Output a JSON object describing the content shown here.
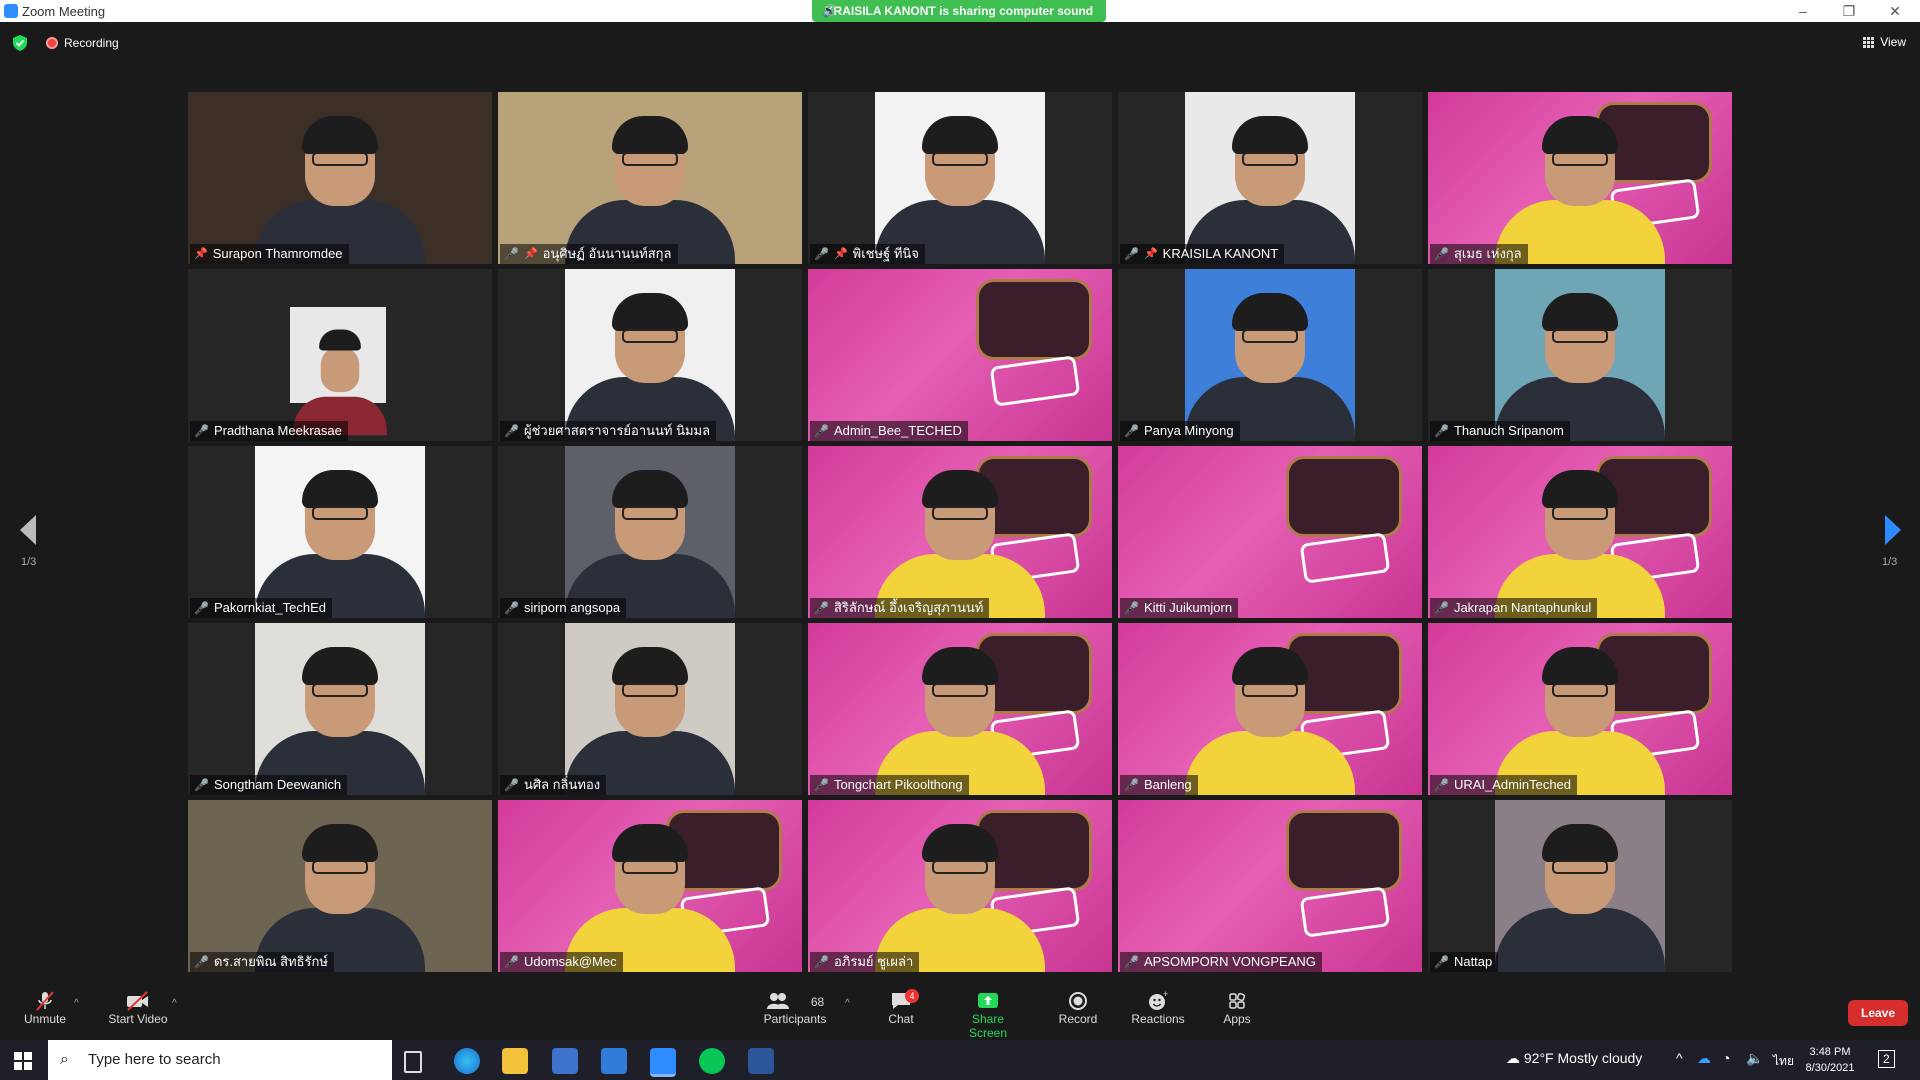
{
  "window": {
    "title": "Zoom Meeting",
    "minimize": "–",
    "maximize": "❐",
    "close": "✕"
  },
  "share_banner": "KRAISILA KANONT is sharing computer sound",
  "recording": {
    "label": "Recording"
  },
  "view": {
    "label": "View"
  },
  "pager": {
    "left": "1/3",
    "right": "1/3"
  },
  "participants": [
    {
      "name": "Surapon Thamromdee",
      "pinned": true,
      "muted": false,
      "bg": "#3b2f27",
      "type": "person"
    },
    {
      "name": "อนุศิษฏ์ อันนานนท์สกุล",
      "pinned": true,
      "muted": true,
      "bg": "#b8a27a",
      "type": "person"
    },
    {
      "name": "พิเชษฐ์ ทีนิจ",
      "pinned": true,
      "muted": true,
      "bg": "#f2f2f2",
      "type": "photo"
    },
    {
      "name": "KRAISILA KANONT",
      "pinned": true,
      "muted": true,
      "bg": "#e9e9e9",
      "type": "photo"
    },
    {
      "name": "สุเมธ เห่งกุล",
      "pinned": false,
      "muted": true,
      "bg": "pink",
      "type": "person"
    },
    {
      "name": "Pradthana Meekrasae",
      "pinned": false,
      "muted": true,
      "bg": "#e8e8e8",
      "type": "small-photo"
    },
    {
      "name": "ผู้ช่วยศาสตราจารย์อานนท์ นิมมล",
      "pinned": false,
      "muted": true,
      "bg": "#f0f0f0",
      "type": "photo"
    },
    {
      "name": "Admin_Bee_TECHED",
      "pinned": false,
      "muted": true,
      "bg": "pink",
      "type": "banner"
    },
    {
      "name": "Panya Minyong",
      "pinned": false,
      "muted": true,
      "bg": "#3d7fd9",
      "type": "photo"
    },
    {
      "name": "Thanuch Sripanom",
      "pinned": false,
      "muted": true,
      "bg": "#6fa6b5",
      "type": "photo"
    },
    {
      "name": "Pakornkiat_TechEd",
      "pinned": false,
      "muted": true,
      "bg": "#f4f4f4",
      "type": "photo"
    },
    {
      "name": "siriporn angsopa",
      "pinned": false,
      "muted": true,
      "bg": "#5d6068",
      "type": "photo"
    },
    {
      "name": "สิริลักษณ์ อึ้งเจริญสุภานนท์",
      "pinned": false,
      "muted": true,
      "bg": "pink",
      "type": "person",
      "active": true
    },
    {
      "name": "Kitti Juikumjorn",
      "pinned": false,
      "muted": true,
      "bg": "pink",
      "type": "banner"
    },
    {
      "name": "Jakrapan Nantaphunkul",
      "pinned": false,
      "muted": true,
      "bg": "pink",
      "type": "person"
    },
    {
      "name": "Songtham Deewanich",
      "pinned": false,
      "muted": true,
      "bg": "#e0ded8",
      "type": "photo"
    },
    {
      "name": "นศิล กลิ่นทอง",
      "pinned": false,
      "muted": true,
      "bg": "#cfcac4",
      "type": "photo"
    },
    {
      "name": "Tongchart Pikoolthong",
      "pinned": false,
      "muted": true,
      "bg": "pink",
      "type": "person"
    },
    {
      "name": "Banleng",
      "pinned": false,
      "muted": true,
      "bg": "pink",
      "type": "person"
    },
    {
      "name": "URAI_AdminTeched",
      "pinned": false,
      "muted": true,
      "bg": "pink",
      "type": "person"
    },
    {
      "name": "ดร.สายพิณ สิทธิรักษ์",
      "pinned": false,
      "muted": true,
      "bg": "#6e6452",
      "type": "person"
    },
    {
      "name": "Udomsak@Mec",
      "pinned": false,
      "muted": true,
      "bg": "pink",
      "type": "person"
    },
    {
      "name": "อภิรมย์ ชูเผล่า",
      "pinned": false,
      "muted": true,
      "bg": "pink",
      "type": "person"
    },
    {
      "name": "APSOMPORN VONGPEANG",
      "pinned": false,
      "muted": true,
      "bg": "pink",
      "type": "banner"
    },
    {
      "name": "Nattap",
      "pinned": false,
      "muted": true,
      "bg": "#8a7f86",
      "type": "photo"
    }
  ],
  "toolbar": {
    "unmute": "Unmute",
    "start_video": "Start Video",
    "participants": "Participants",
    "participants_count": "68",
    "chat": "Chat",
    "chat_badge": "4",
    "share_screen": "Share Screen",
    "record": "Record",
    "reactions": "Reactions",
    "apps": "Apps",
    "leave": "Leave"
  },
  "taskbar": {
    "search_placeholder": "Type here to search",
    "weather": "92°F  Mostly cloudy",
    "lang": "ไทย",
    "time": "3:48 PM",
    "date": "8/30/2021",
    "notif": "2"
  },
  "colors": {
    "accent_green": "#3fbf52",
    "leave_red": "#d62d2d",
    "zoom_blue": "#2D8CFF",
    "mute_red": "#e33333"
  }
}
